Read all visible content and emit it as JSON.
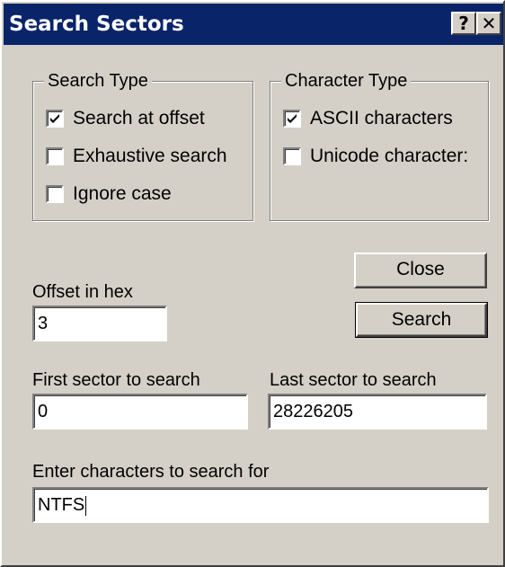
{
  "window": {
    "title": "Search Sectors",
    "help_button": "?",
    "close_button": "✕"
  },
  "search_type": {
    "legend": "Search Type",
    "options": [
      {
        "label": "Search at offset",
        "checked": true
      },
      {
        "label": "Exhaustive search",
        "checked": false
      },
      {
        "label": "Ignore case",
        "checked": false
      }
    ]
  },
  "character_type": {
    "legend": "Character Type",
    "options": [
      {
        "label": "ASCII characters",
        "checked": true
      },
      {
        "label": "Unicode character:",
        "checked": false
      }
    ]
  },
  "offset": {
    "label": "Offset in hex",
    "value": "3"
  },
  "first_sector": {
    "label": "First sector to search",
    "value": "0"
  },
  "last_sector": {
    "label": "Last sector to search",
    "value": "28226205"
  },
  "search_chars": {
    "label": "Enter characters to search for",
    "value": "NTFS"
  },
  "buttons": {
    "close": "Close",
    "search": "Search"
  }
}
